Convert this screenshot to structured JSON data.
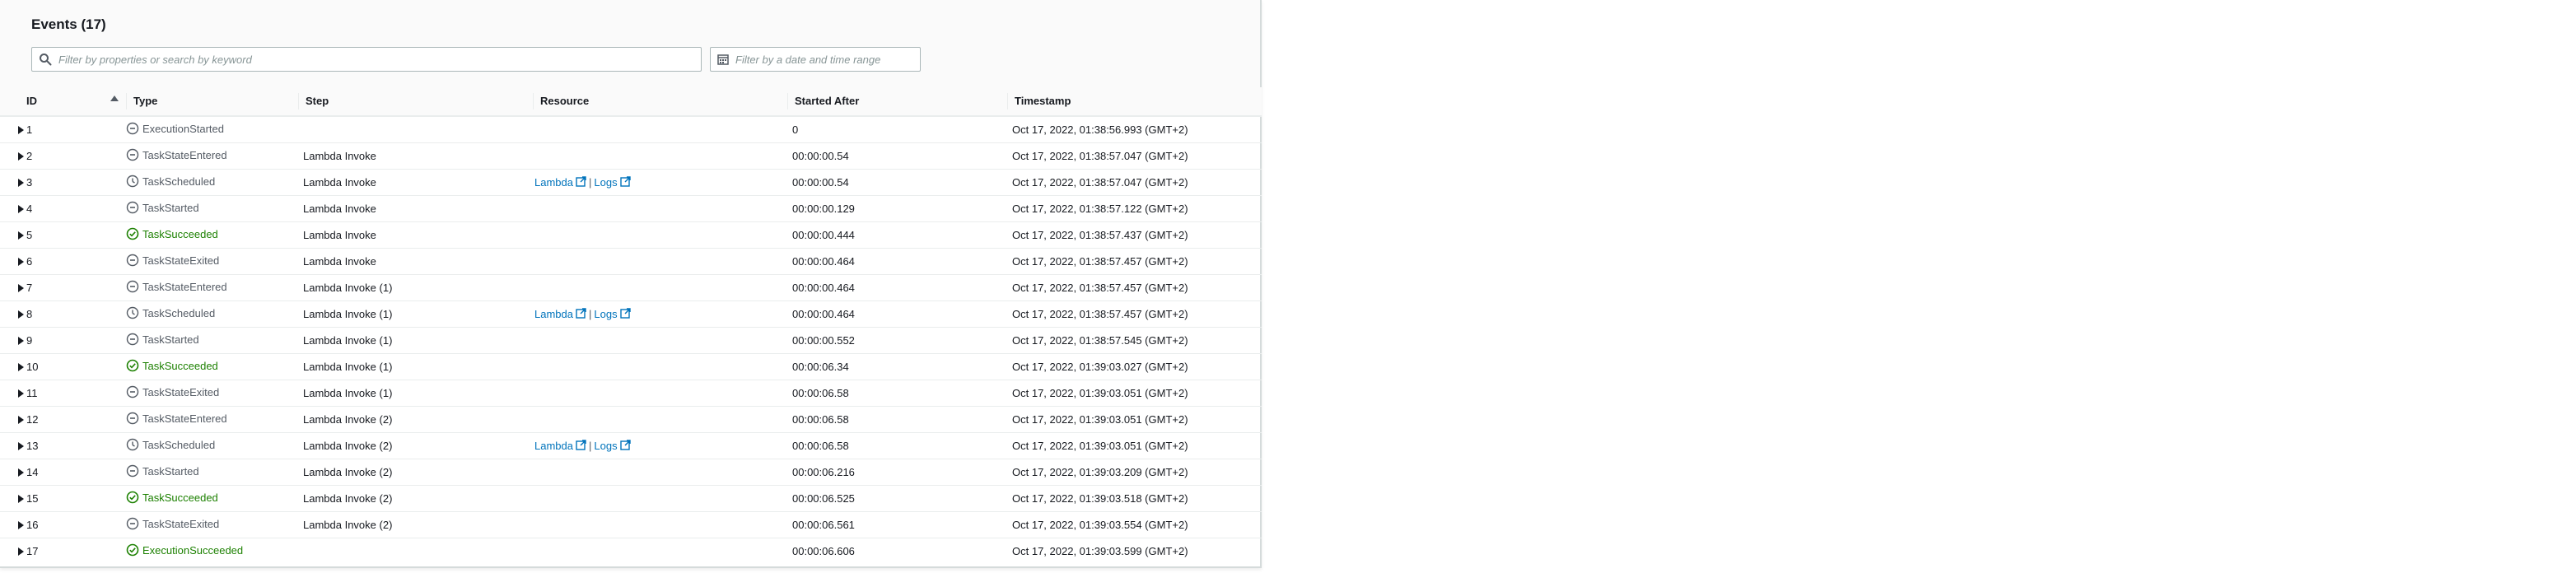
{
  "panel": {
    "title": "Events (17)"
  },
  "filters": {
    "search_placeholder": "Filter by properties or search by keyword",
    "date_placeholder": "Filter by a date and time range"
  },
  "table": {
    "columns": {
      "id": "ID",
      "type": "Type",
      "step": "Step",
      "resource": "Resource",
      "started_after": "Started After",
      "timestamp": "Timestamp"
    },
    "sort": {
      "column": "id",
      "direction": "ascending"
    },
    "link_labels": {
      "lambda": "Lambda",
      "logs": "Logs",
      "separator": "|"
    },
    "rows": [
      {
        "id": "1",
        "type": "ExecutionStarted",
        "status": "neutral",
        "step": "",
        "links": false,
        "started_after": "0",
        "timestamp": "Oct 17, 2022, 01:38:56.993 (GMT+2)"
      },
      {
        "id": "2",
        "type": "TaskStateEntered",
        "status": "neutral",
        "step": "Lambda Invoke",
        "links": false,
        "started_after": "00:00:00.54",
        "timestamp": "Oct 17, 2022, 01:38:57.047 (GMT+2)"
      },
      {
        "id": "3",
        "type": "TaskScheduled",
        "status": "scheduled",
        "step": "Lambda Invoke",
        "links": true,
        "started_after": "00:00:00.54",
        "timestamp": "Oct 17, 2022, 01:38:57.047 (GMT+2)"
      },
      {
        "id": "4",
        "type": "TaskStarted",
        "status": "neutral",
        "step": "Lambda Invoke",
        "links": false,
        "started_after": "00:00:00.129",
        "timestamp": "Oct 17, 2022, 01:38:57.122 (GMT+2)"
      },
      {
        "id": "5",
        "type": "TaskSucceeded",
        "status": "success",
        "step": "Lambda Invoke",
        "links": false,
        "started_after": "00:00:00.444",
        "timestamp": "Oct 17, 2022, 01:38:57.437 (GMT+2)"
      },
      {
        "id": "6",
        "type": "TaskStateExited",
        "status": "neutral",
        "step": "Lambda Invoke",
        "links": false,
        "started_after": "00:00:00.464",
        "timestamp": "Oct 17, 2022, 01:38:57.457 (GMT+2)"
      },
      {
        "id": "7",
        "type": "TaskStateEntered",
        "status": "neutral",
        "step": "Lambda Invoke (1)",
        "links": false,
        "started_after": "00:00:00.464",
        "timestamp": "Oct 17, 2022, 01:38:57.457 (GMT+2)"
      },
      {
        "id": "8",
        "type": "TaskScheduled",
        "status": "scheduled",
        "step": "Lambda Invoke (1)",
        "links": true,
        "started_after": "00:00:00.464",
        "timestamp": "Oct 17, 2022, 01:38:57.457 (GMT+2)"
      },
      {
        "id": "9",
        "type": "TaskStarted",
        "status": "neutral",
        "step": "Lambda Invoke (1)",
        "links": false,
        "started_after": "00:00:00.552",
        "timestamp": "Oct 17, 2022, 01:38:57.545 (GMT+2)"
      },
      {
        "id": "10",
        "type": "TaskSucceeded",
        "status": "success",
        "step": "Lambda Invoke (1)",
        "links": false,
        "started_after": "00:00:06.34",
        "timestamp": "Oct 17, 2022, 01:39:03.027 (GMT+2)"
      },
      {
        "id": "11",
        "type": "TaskStateExited",
        "status": "neutral",
        "step": "Lambda Invoke (1)",
        "links": false,
        "started_after": "00:00:06.58",
        "timestamp": "Oct 17, 2022, 01:39:03.051 (GMT+2)"
      },
      {
        "id": "12",
        "type": "TaskStateEntered",
        "status": "neutral",
        "step": "Lambda Invoke (2)",
        "links": false,
        "started_after": "00:00:06.58",
        "timestamp": "Oct 17, 2022, 01:39:03.051 (GMT+2)"
      },
      {
        "id": "13",
        "type": "TaskScheduled",
        "status": "scheduled",
        "step": "Lambda Invoke (2)",
        "links": true,
        "started_after": "00:00:06.58",
        "timestamp": "Oct 17, 2022, 01:39:03.051 (GMT+2)"
      },
      {
        "id": "14",
        "type": "TaskStarted",
        "status": "neutral",
        "step": "Lambda Invoke (2)",
        "links": false,
        "started_after": "00:00:06.216",
        "timestamp": "Oct 17, 2022, 01:39:03.209 (GMT+2)"
      },
      {
        "id": "15",
        "type": "TaskSucceeded",
        "status": "success",
        "step": "Lambda Invoke (2)",
        "links": false,
        "started_after": "00:00:06.525",
        "timestamp": "Oct 17, 2022, 01:39:03.518 (GMT+2)"
      },
      {
        "id": "16",
        "type": "TaskStateExited",
        "status": "neutral",
        "step": "Lambda Invoke (2)",
        "links": false,
        "started_after": "00:00:06.561",
        "timestamp": "Oct 17, 2022, 01:39:03.554 (GMT+2)"
      },
      {
        "id": "17",
        "type": "ExecutionSucceeded",
        "status": "success",
        "step": "",
        "links": false,
        "started_after": "00:00:06.606",
        "timestamp": "Oct 17, 2022, 01:39:03.599 (GMT+2)"
      }
    ]
  },
  "icons": {
    "search": "search-icon",
    "calendar": "calendar-icon",
    "expand": "caret-right-icon",
    "sort": "sort-ascending-icon",
    "neutral": "minus-circle-icon",
    "scheduled": "clock-circle-icon",
    "success": "check-circle-icon",
    "external": "external-link-icon"
  },
  "colors": {
    "link": "#0073bb",
    "success": "#1d8102",
    "neutral": "#545b64",
    "border": "#eaeded",
    "header_bg": "#fafafa"
  }
}
